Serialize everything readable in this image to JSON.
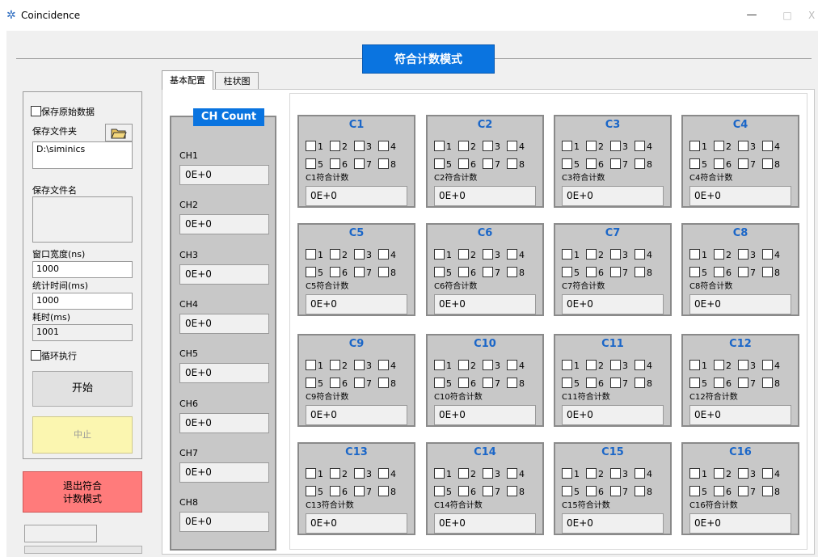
{
  "window": {
    "title": "Coincidence",
    "icon": "app-icon",
    "minimize": "—",
    "maximize": "□",
    "close": "X"
  },
  "banner": "符合计数模式",
  "left": {
    "save_raw": "保存原始数据",
    "save_folder_label": "保存文件夹",
    "save_folder_value": "D:\\siminics",
    "save_filename_label": "保存文件名",
    "window_width_label": "窗口宽度(ns)",
    "window_width_value": "1000",
    "stat_time_label": "统计时间(ms)",
    "stat_time_value": "1000",
    "elapsed_label": "耗时(ms)",
    "elapsed_value": "1001",
    "loop_label": "循环执行",
    "start_button": "开始",
    "stop_button": "中止",
    "exit_button_line1": "退出符合",
    "exit_button_line2": "计数模式"
  },
  "tabs": [
    "基本配置",
    "柱状图"
  ],
  "ch_panel": {
    "title": "CH Count",
    "channels": [
      {
        "label": "CH1",
        "value": "0E+0"
      },
      {
        "label": "CH2",
        "value": "0E+0"
      },
      {
        "label": "CH3",
        "value": "0E+0"
      },
      {
        "label": "CH4",
        "value": "0E+0"
      },
      {
        "label": "CH5",
        "value": "0E+0"
      },
      {
        "label": "CH6",
        "value": "0E+0"
      },
      {
        "label": "CH7",
        "value": "0E+0"
      },
      {
        "label": "CH8",
        "value": "0E+0"
      }
    ]
  },
  "cards": [
    {
      "title": "C1",
      "label": "C1符合计数",
      "value": "0E+0"
    },
    {
      "title": "C2",
      "label": "C2符合计数",
      "value": "0E+0"
    },
    {
      "title": "C3",
      "label": "C3符合计数",
      "value": "0E+0"
    },
    {
      "title": "C4",
      "label": "C4符合计数",
      "value": "0E+0"
    },
    {
      "title": "C5",
      "label": "C5符合计数",
      "value": "0E+0"
    },
    {
      "title": "C6",
      "label": "C6符合计数",
      "value": "0E+0"
    },
    {
      "title": "C7",
      "label": "C7符合计数",
      "value": "0E+0"
    },
    {
      "title": "C8",
      "label": "C8符合计数",
      "value": "0E+0"
    },
    {
      "title": "C9",
      "label": "C9符合计数",
      "value": "0E+0"
    },
    {
      "title": "C10",
      "label": "C10符合计数",
      "value": "0E+0"
    },
    {
      "title": "C11",
      "label": "C11符合计数",
      "value": "0E+0"
    },
    {
      "title": "C12",
      "label": "C12符合计数",
      "value": "0E+0"
    },
    {
      "title": "C13",
      "label": "C13符合计数",
      "value": "0E+0"
    },
    {
      "title": "C14",
      "label": "C14符合计数",
      "value": "0E+0"
    },
    {
      "title": "C15",
      "label": "C15符合计数",
      "value": "0E+0"
    },
    {
      "title": "C16",
      "label": "C16符合计数",
      "value": "0E+0"
    }
  ],
  "channel_numbers": [
    "1",
    "2",
    "3",
    "4",
    "5",
    "6",
    "7",
    "8"
  ],
  "colors": {
    "banner_bg": "#0a74e0",
    "title_text": "#1a66c8",
    "stop_bg": "#fbf6b0",
    "exit_bg": "#ff7b7b",
    "panel_gray": "#c8c8c8"
  }
}
